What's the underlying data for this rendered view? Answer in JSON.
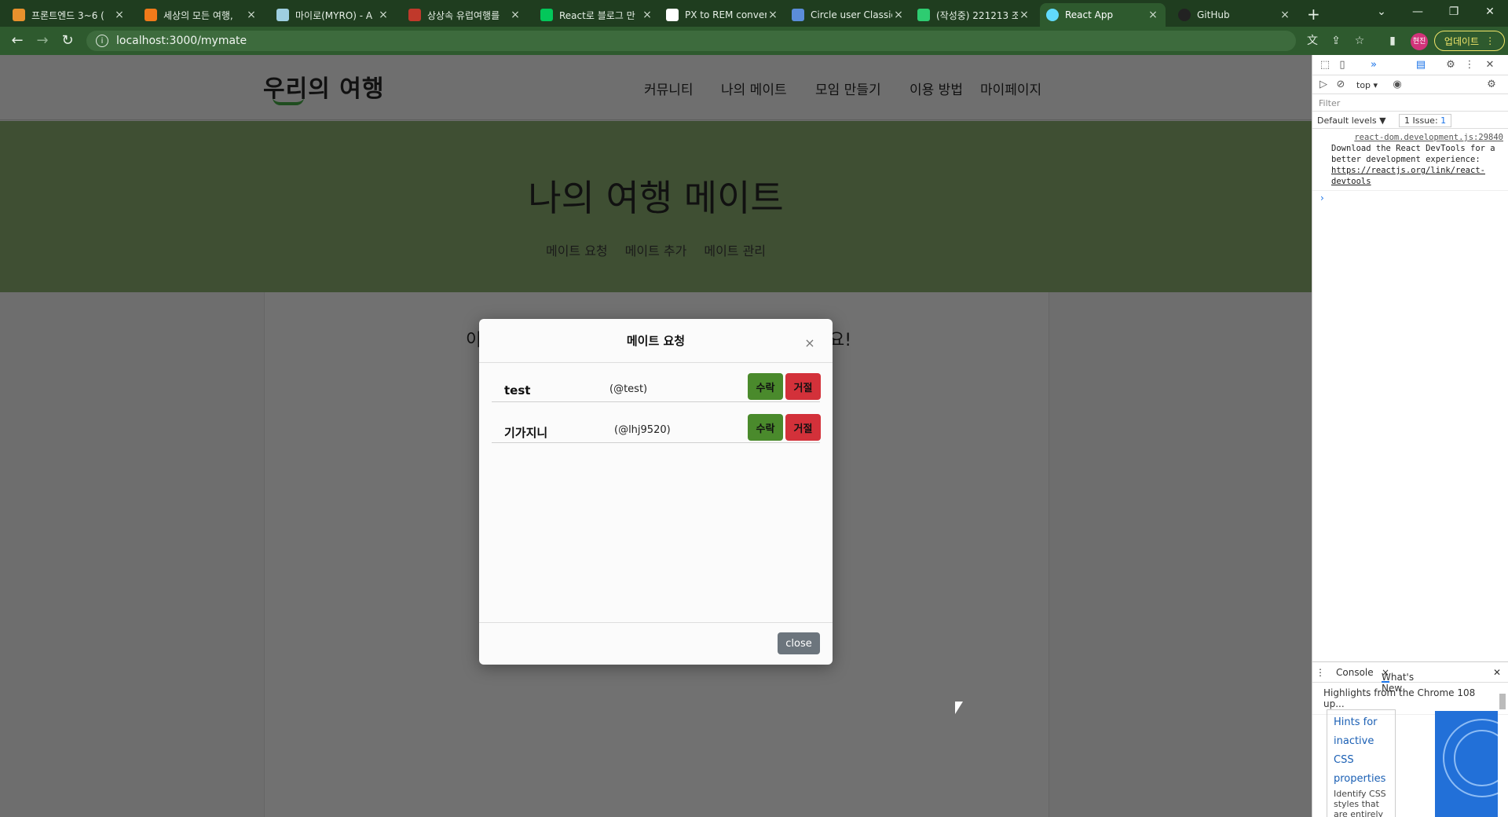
{
  "browser": {
    "tabs": [
      {
        "title": "프론트엔드 3~6 (",
        "active": false
      },
      {
        "title": "세상의 모든 여행,",
        "active": false
      },
      {
        "title": "마이로(MYRO) - A",
        "active": false
      },
      {
        "title": "상상속 유럽여행를",
        "active": false
      },
      {
        "title": "React로 블로그 만",
        "active": false
      },
      {
        "title": "PX to REM conver",
        "active": false
      },
      {
        "title": "Circle user Classic",
        "active": false
      },
      {
        "title": "(작성중) 221213 조",
        "active": false
      },
      {
        "title": "React App",
        "active": true
      },
      {
        "title": "GitHub",
        "active": false
      }
    ],
    "url": "localhost:3000/mymate",
    "profile_initials": "현진",
    "update_label": "업데이트"
  },
  "site": {
    "logo": "우리의 여행",
    "nav": [
      "커뮤니티",
      "나의 메이트",
      "모임 만들기",
      "이용 방법",
      "마이페이지"
    ],
    "hero_title": "나의 여행 메이트",
    "hero_nav": [
      "메이트 요청",
      "메이트 추가",
      "메이트 관리"
    ],
    "behind_text_left": "이",
    "behind_text_right": "요!"
  },
  "modal": {
    "title": "메이트 요청",
    "requests": [
      {
        "name": "test",
        "handle": "(@test)",
        "accept_label": "수락",
        "reject_label": "거절"
      },
      {
        "name": "기가지니",
        "handle": "(@lhj9520)",
        "accept_label": "수락",
        "reject_label": "거절"
      }
    ],
    "close_label": "close"
  },
  "devtools": {
    "context": "top",
    "filter_placeholder": "Filter",
    "levels_label": "Default levels ▼",
    "issues_label": "1 Issue:",
    "issues_count": "1",
    "log_source": "react-dom.development.js:29840",
    "log_text": "Download the React DevTools for a better development experience: ",
    "log_link": "https://reactjs.org/link/react-devtools",
    "drawer_tab_console": "Console",
    "drawer_tab_whatsnew": "What's New",
    "highlights": "Highlights from the Chrome 108 up...",
    "card_heading": "Hints for inactive CSS properties",
    "card_body": "Identify CSS styles that are entirely"
  },
  "colors": {
    "hero_bg": "#3f4f33",
    "accept": "#4a8a2c",
    "reject": "#d3313a",
    "close_btn": "#6c757d"
  }
}
